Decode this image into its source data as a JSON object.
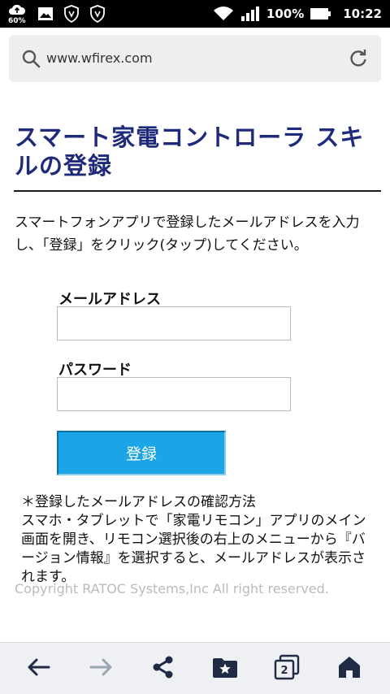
{
  "status_bar": {
    "battery_small": "60%",
    "battery_percent": "100%",
    "time": "10:22",
    "icons": [
      "cloud-upload-icon",
      "image-icon",
      "vpn-shield-icon",
      "vpn-shield-icon",
      "wifi-icon",
      "signal-icon",
      "battery-icon"
    ]
  },
  "browser": {
    "url": "www.wfirex.com",
    "icons": [
      "search-icon",
      "reload-icon"
    ]
  },
  "page": {
    "title": "スマート家電コントローラ スキルの登録",
    "instructions": "スマートフォンアプリで登録したメールアドレスを入力し、「登録」をクリック(タップ)してください。",
    "email_label": "メールアドレス",
    "email_value": "",
    "password_label": "パスワード",
    "password_value": "",
    "register_button": "登録",
    "note": "＊登録したメールアドレスの確認方法\nスマホ・タブレットで「家電リモコン」アプリのメイン画面を開き、リモコン選択後の右上のメニューから『バージョン情報』を選択すると、メールアドレスが表示されます。",
    "copyright": "Copyright RATOC Systems,Inc All right reserved."
  },
  "bottom_nav": {
    "tab_count": "2",
    "icons": [
      "back-arrow-icon",
      "forward-arrow-icon",
      "share-icon",
      "bookmarks-folder-icon",
      "tabs-icon",
      "home-icon"
    ]
  },
  "colors": {
    "title": "#1f2a7a",
    "button": "#1ba5e6",
    "statusbar": "#000000",
    "nav_icon": "#1f2a44",
    "nav_icon_disabled": "#9aa7b3"
  }
}
